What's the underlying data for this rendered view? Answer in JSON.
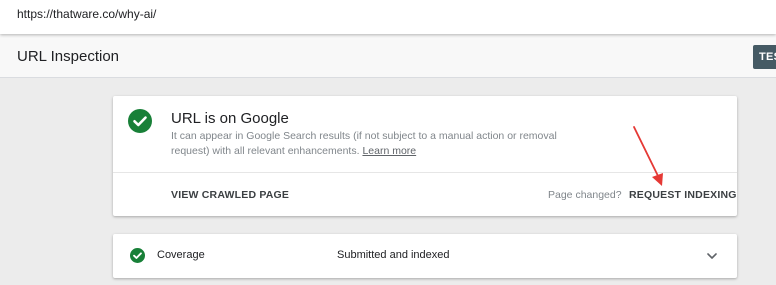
{
  "browser": {
    "url": "https://thatware.co/why-ai/"
  },
  "header": {
    "title": "URL Inspection",
    "test_button_label": "TES"
  },
  "status_card": {
    "title": "URL is on Google",
    "description": "It can appear in Google Search results (if not subject to a manual action or removal request) with all relevant enhancements.",
    "learn_more": "Learn more",
    "view_crawled_label": "VIEW CRAWLED PAGE",
    "page_changed_label": "Page changed?",
    "request_indexing_label": "REQUEST INDEXING",
    "status_color": "#188038"
  },
  "coverage": {
    "label": "Coverage",
    "status": "Submitted and indexed"
  },
  "icons": {
    "status": "check-circle-icon",
    "coverage_status": "check-circle-icon",
    "expand": "chevron-down-icon"
  },
  "annotation": {
    "arrow_color": "#e53935"
  }
}
